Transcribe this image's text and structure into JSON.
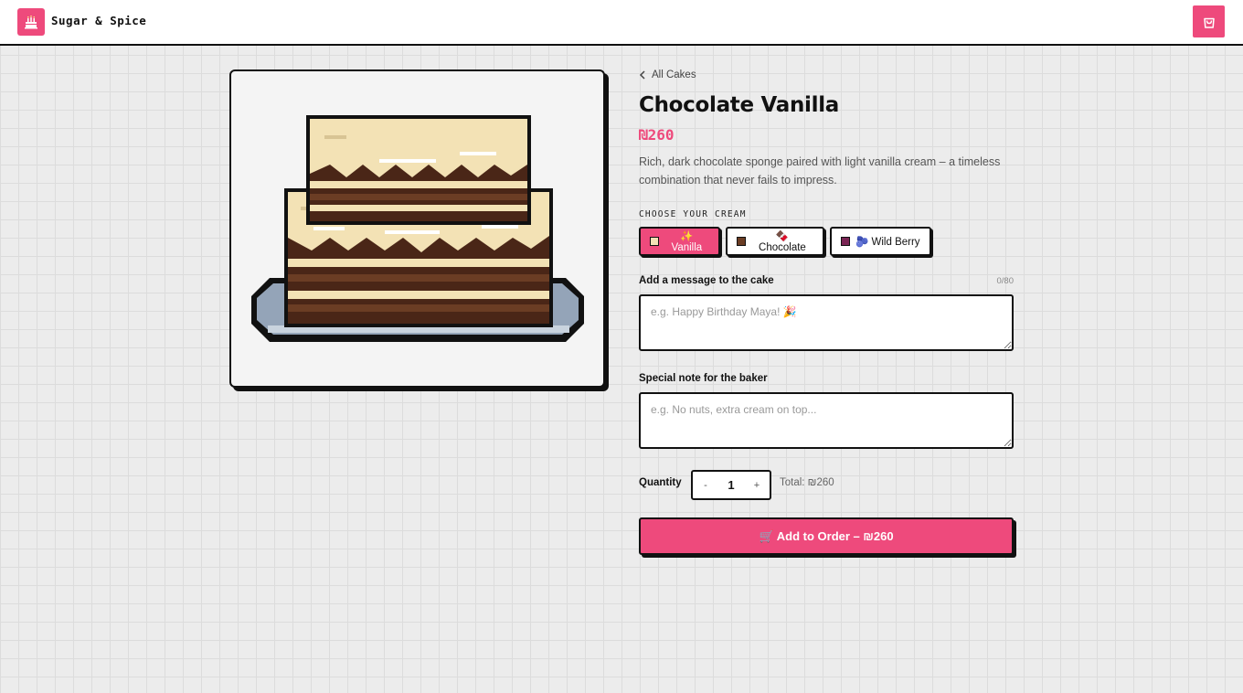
{
  "header": {
    "brand": "Sugar & Spice",
    "logo_icon": "cake-icon",
    "cart_icon": "shopping-bag-icon"
  },
  "product": {
    "back_label": "All Cakes",
    "title": "Chocolate Vanilla",
    "price": "₪260",
    "description": "Rich, dark chocolate sponge paired with light vanilla cream – a timeless combination that never fails to impress."
  },
  "cream": {
    "label": "CHOOSE YOUR CREAM",
    "options": [
      {
        "label": "✨ Vanilla",
        "swatch": "#f3e2b5",
        "selected": true
      },
      {
        "label": "🍫 Chocolate",
        "swatch": "#6b3d24",
        "selected": false
      },
      {
        "label": "🫐 Wild Berry",
        "swatch": "#7a2454",
        "selected": false
      }
    ]
  },
  "message": {
    "label": "Add a message to the cake",
    "counter": "0/80",
    "placeholder": "e.g. Happy Birthday Maya! 🎉"
  },
  "note": {
    "label": "Special note for the baker",
    "placeholder": "e.g. No nuts, extra cream on top..."
  },
  "quantity": {
    "label": "Quantity",
    "minus": "-",
    "value": "1",
    "plus": "+",
    "total": "Total: ₪260"
  },
  "cta": {
    "label": "🛒 Add to Order – ₪260"
  },
  "colors": {
    "accent": "#ee4a7c",
    "border": "#111111",
    "background": "#ececec"
  }
}
